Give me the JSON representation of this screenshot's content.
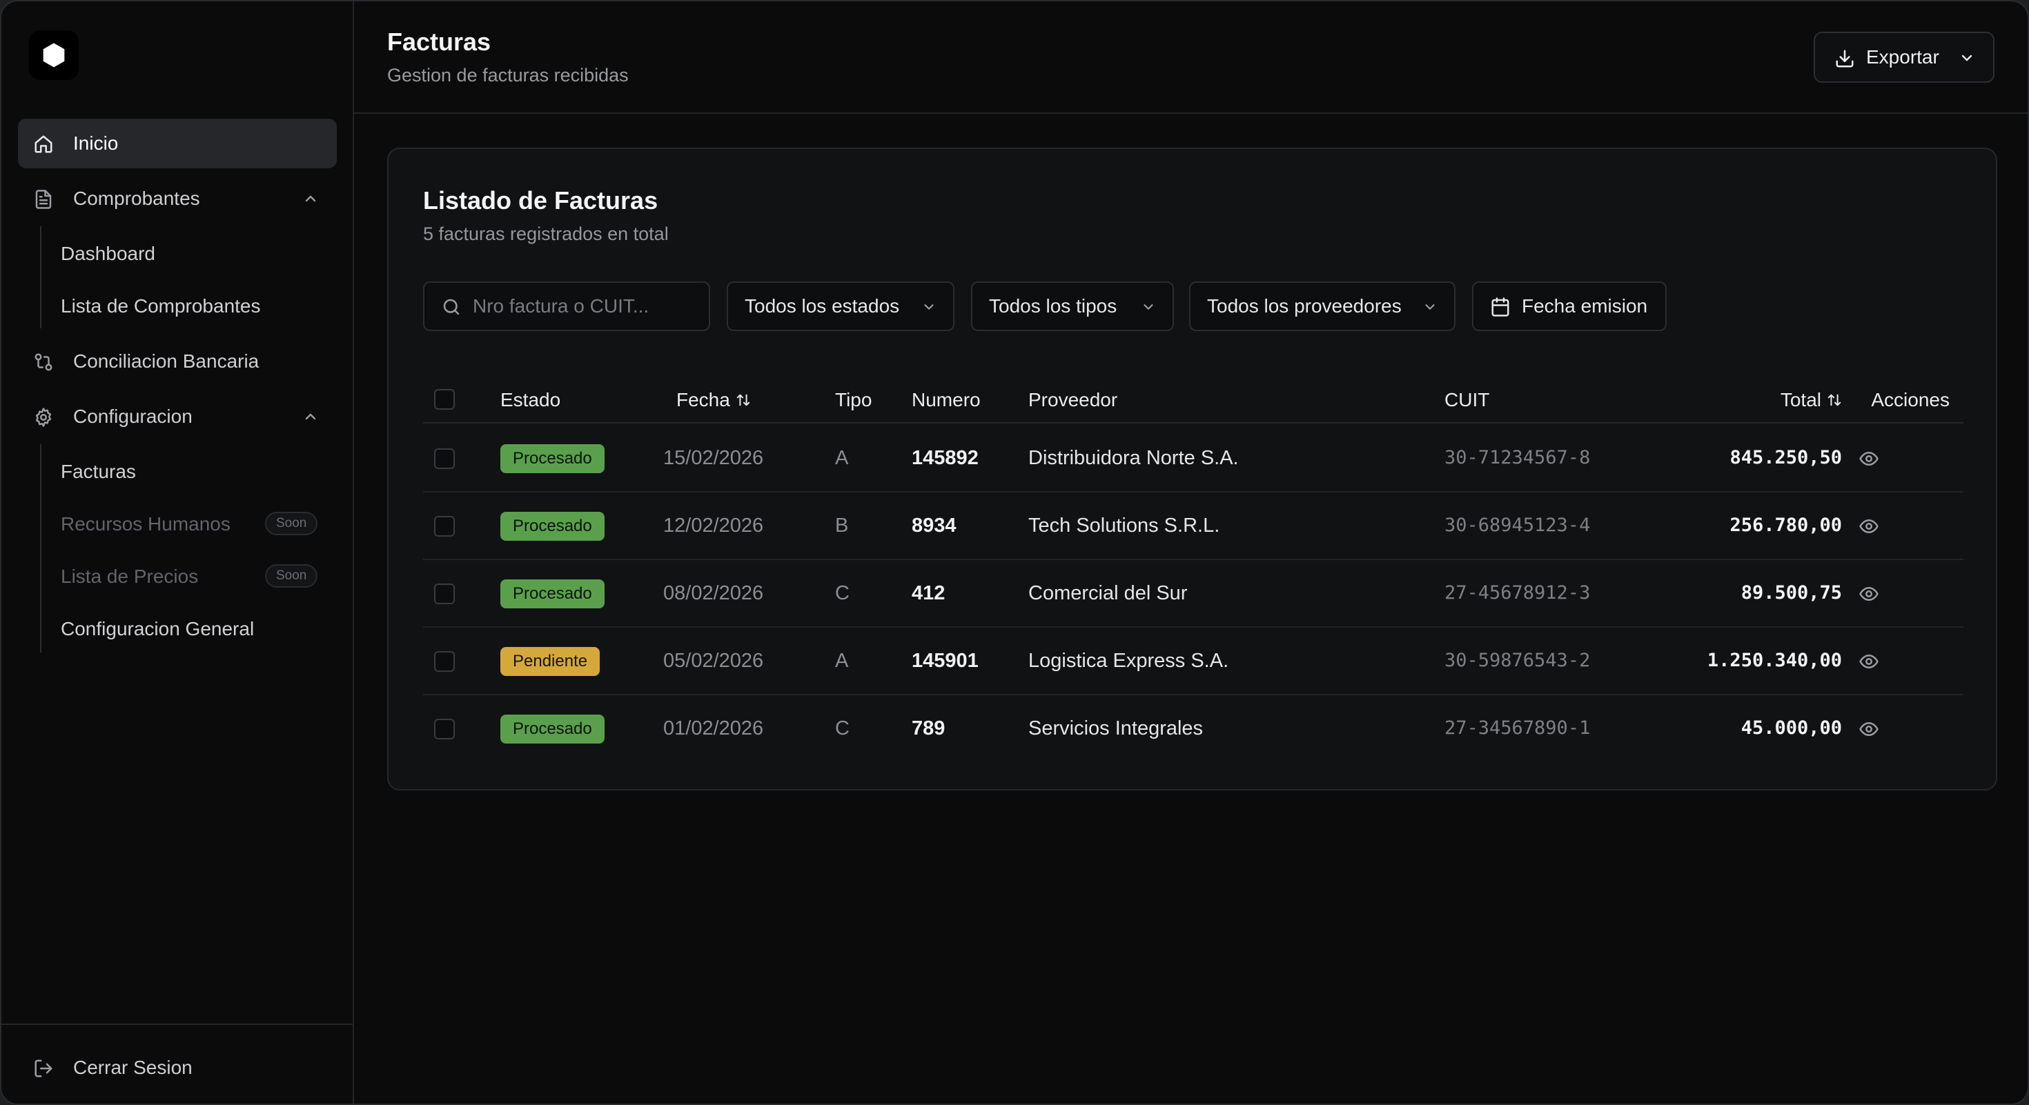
{
  "sidebar": {
    "items": [
      {
        "label": "Inicio",
        "icon": "home-icon"
      },
      {
        "label": "Comprobantes",
        "icon": "file-text-icon"
      },
      {
        "label": "Conciliacion Bancaria",
        "icon": "git-compare-icon"
      },
      {
        "label": "Configuracion",
        "icon": "gear-icon"
      }
    ],
    "comprobantes_sub": [
      "Dashboard",
      "Lista de Comprobantes"
    ],
    "configuracion_sub": [
      {
        "label": "Facturas"
      },
      {
        "label": "Recursos Humanos",
        "badge": "Soon"
      },
      {
        "label": "Lista de Precios",
        "badge": "Soon"
      },
      {
        "label": "Configuracion General"
      }
    ],
    "logout_label": "Cerrar Sesion"
  },
  "header": {
    "title": "Facturas",
    "subtitle": "Gestion de facturas recibidas",
    "export_label": "Exportar"
  },
  "card": {
    "title": "Listado de Facturas",
    "subtitle": "5 facturas registrados en total"
  },
  "filters": {
    "search_placeholder": "Nro factura o CUIT...",
    "estado": "Todos los estados",
    "tipo": "Todos los tipos",
    "proveedor": "Todos los proveedores",
    "fecha": "Fecha emision"
  },
  "table": {
    "columns": {
      "estado": "Estado",
      "fecha": "Fecha",
      "tipo": "Tipo",
      "numero": "Numero",
      "proveedor": "Proveedor",
      "cuit": "CUIT",
      "total": "Total",
      "acciones": "Acciones"
    },
    "rows": [
      {
        "estado": "Procesado",
        "fecha": "15/02/2026",
        "tipo": "A",
        "numero": "145892",
        "proveedor": "Distribuidora Norte S.A.",
        "cuit": "30-71234567-8",
        "total": "845.250,50"
      },
      {
        "estado": "Procesado",
        "fecha": "12/02/2026",
        "tipo": "B",
        "numero": "8934",
        "proveedor": "Tech Solutions S.R.L.",
        "cuit": "30-68945123-4",
        "total": "256.780,00"
      },
      {
        "estado": "Procesado",
        "fecha": "08/02/2026",
        "tipo": "C",
        "numero": "412",
        "proveedor": "Comercial del Sur",
        "cuit": "27-45678912-3",
        "total": "89.500,75"
      },
      {
        "estado": "Pendiente",
        "fecha": "05/02/2026",
        "tipo": "A",
        "numero": "145901",
        "proveedor": "Logistica Express S.A.",
        "cuit": "30-59876543-2",
        "total": "1.250.340,00"
      },
      {
        "estado": "Procesado",
        "fecha": "01/02/2026",
        "tipo": "C",
        "numero": "789",
        "proveedor": "Servicios Integrales",
        "cuit": "27-34567890-1",
        "total": "45.000,00"
      }
    ]
  },
  "colors": {
    "background": "#0b0b0c",
    "status_procesado": "#5aa04c",
    "status_pendiente": "#d5a83c"
  }
}
